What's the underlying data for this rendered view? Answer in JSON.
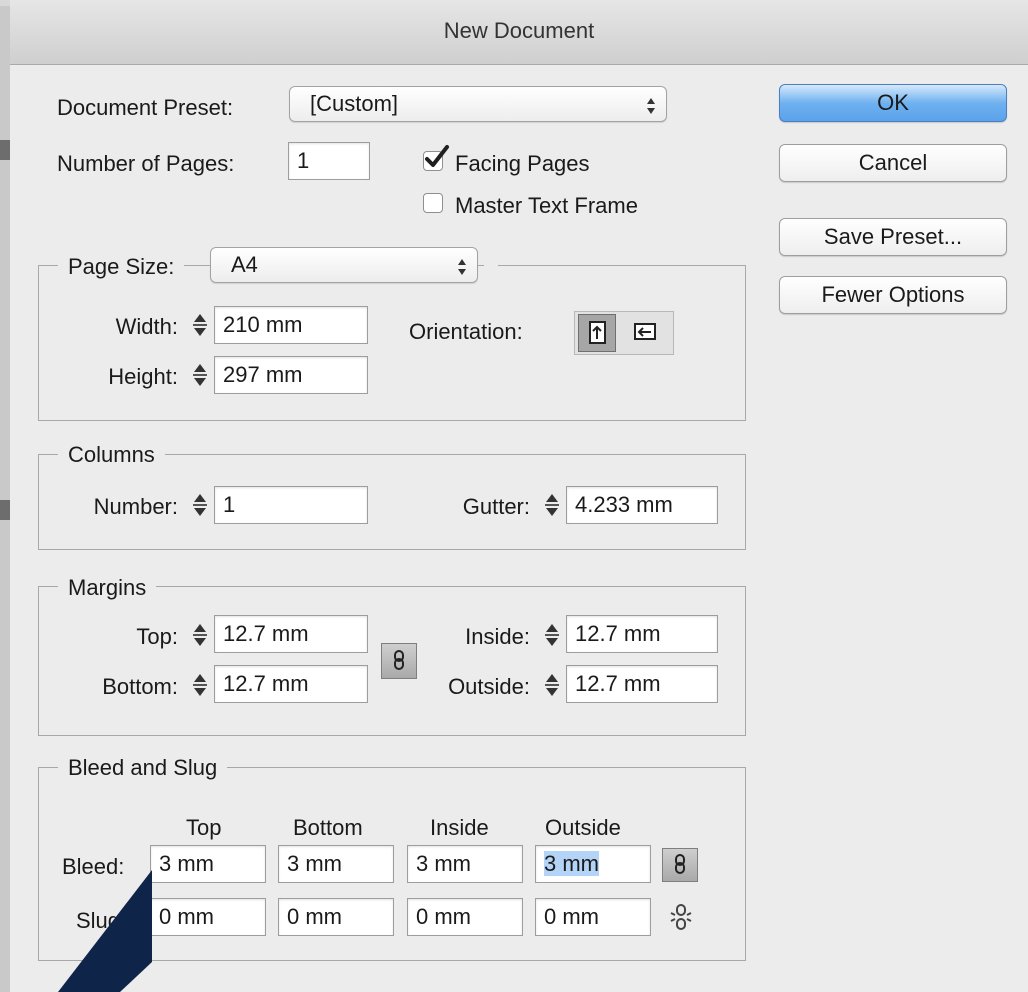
{
  "window": {
    "title": "New Document"
  },
  "doc": {
    "preset_label": "Document Preset:",
    "preset_value": "[Custom]",
    "pages_label": "Number of Pages:",
    "pages_value": "1",
    "facing_pages_label": "Facing Pages",
    "facing_pages_checked": true,
    "master_text_frame_label": "Master Text Frame",
    "master_text_frame_checked": false
  },
  "buttons": {
    "ok": "OK",
    "cancel": "Cancel",
    "save_preset": "Save Preset...",
    "fewer_options": "Fewer Options"
  },
  "page_size": {
    "legend": "Page Size:",
    "value": "A4",
    "width_label": "Width:",
    "width_value": "210 mm",
    "height_label": "Height:",
    "height_value": "297 mm",
    "orientation_label": "Orientation:",
    "orientation_selected": "portrait"
  },
  "columns": {
    "legend": "Columns",
    "number_label": "Number:",
    "number_value": "1",
    "gutter_label": "Gutter:",
    "gutter_value": "4.233 mm"
  },
  "margins": {
    "legend": "Margins",
    "top_label": "Top:",
    "top_value": "12.7 mm",
    "bottom_label": "Bottom:",
    "bottom_value": "12.7 mm",
    "inside_label": "Inside:",
    "inside_value": "12.7 mm",
    "outside_label": "Outside:",
    "outside_value": "12.7 mm"
  },
  "bleed_slug": {
    "legend": "Bleed and Slug",
    "col_top": "Top",
    "col_bottom": "Bottom",
    "col_inside": "Inside",
    "col_outside": "Outside",
    "bleed_label": "Bleed:",
    "bleed_values": [
      "3 mm",
      "3 mm",
      "3 mm",
      "3 mm"
    ],
    "slug_label": "Slug:",
    "slug_values": [
      "0 mm",
      "0 mm",
      "0 mm",
      "0 mm"
    ]
  },
  "colors": {
    "dialog_bg": "#ececec",
    "ok_button": "#6fb1f0",
    "selection": "#b3d3f7",
    "overlay_arrow": "#0f2449"
  }
}
